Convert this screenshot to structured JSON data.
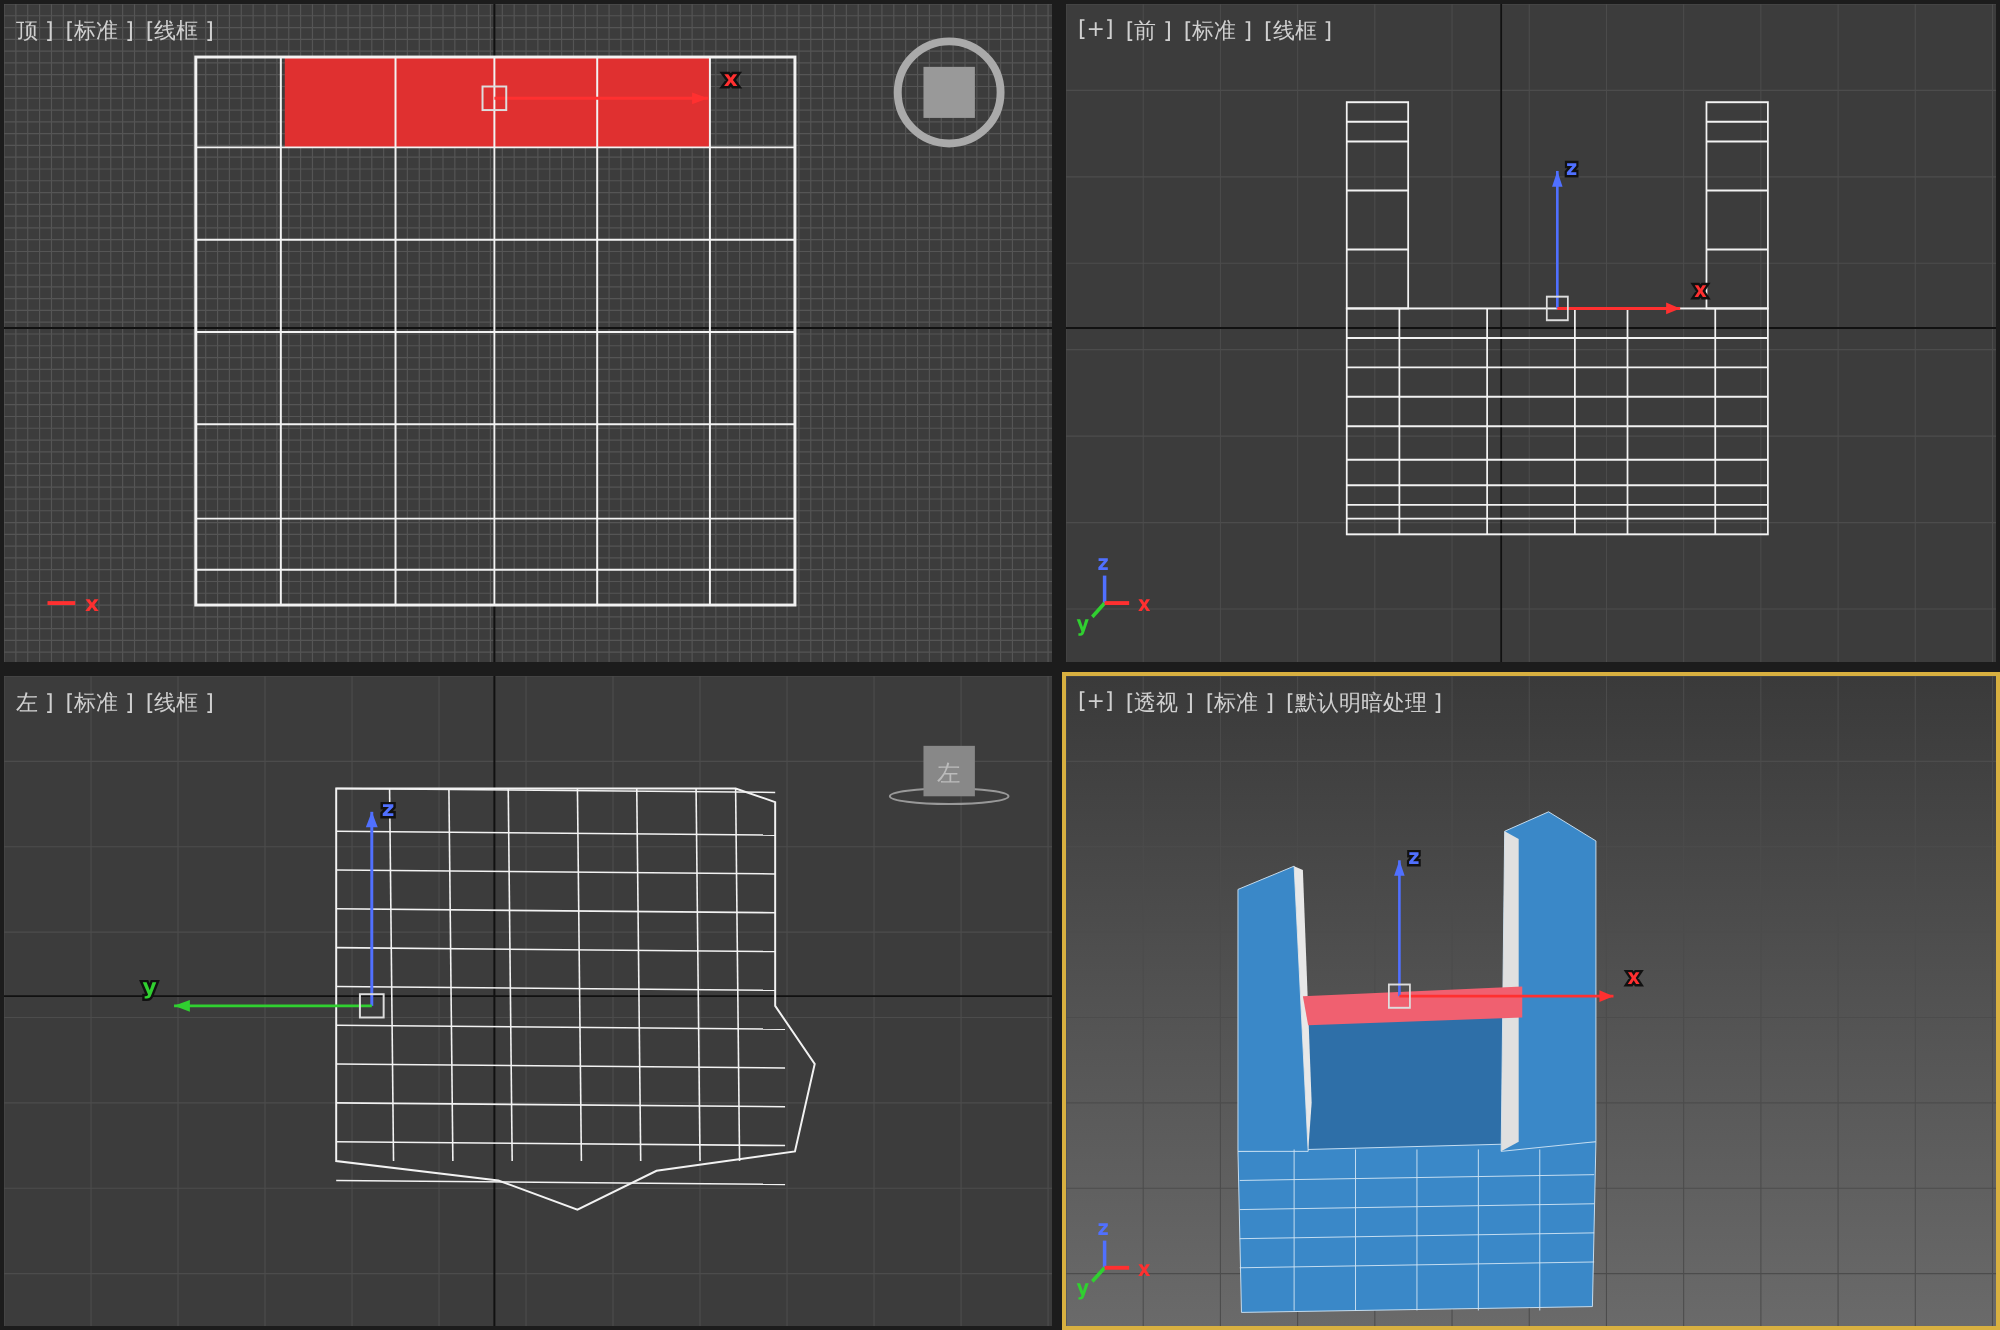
{
  "viewports": [
    {
      "kind": "top",
      "active": false,
      "labels": [
        "顶 ]",
        "[标准 ]",
        "[线框 ]"
      ],
      "gizmo": [
        {
          "label": "x",
          "color": "#ff3030"
        }
      ],
      "corner_axes": [
        {
          "label": "x",
          "color": "#ff3030"
        }
      ]
    },
    {
      "kind": "front",
      "active": false,
      "labels": [
        "[+]",
        "[前 ]",
        "[标准 ]",
        "[线框 ]"
      ],
      "gizmo": [
        {
          "label": "z",
          "color": "#5070ff"
        },
        {
          "label": "x",
          "color": "#ff3030"
        }
      ],
      "corner_axes": [
        {
          "label": "z",
          "color": "#5070ff"
        },
        {
          "label": "y",
          "color": "#30d030"
        },
        {
          "label": "x",
          "color": "#ff3030"
        }
      ]
    },
    {
      "kind": "left",
      "active": false,
      "labels": [
        "左 ]",
        "[标准 ]",
        "[线框 ]"
      ],
      "cube_label": "左",
      "gizmo": [
        {
          "label": "z",
          "color": "#5070ff"
        },
        {
          "label": "y",
          "color": "#30d030"
        }
      ]
    },
    {
      "kind": "perspective",
      "active": true,
      "labels": [
        "[+]",
        "[透视 ]",
        "[标准 ]",
        "[默认明暗处理 ]"
      ],
      "gizmo": [
        {
          "label": "z",
          "color": "#5070ff"
        },
        {
          "label": "x",
          "color": "#ff3030"
        }
      ],
      "corner_axes": [
        {
          "label": "z",
          "color": "#5070ff"
        },
        {
          "label": "y",
          "color": "#30d030"
        },
        {
          "label": "x",
          "color": "#ff3030"
        }
      ]
    }
  ]
}
